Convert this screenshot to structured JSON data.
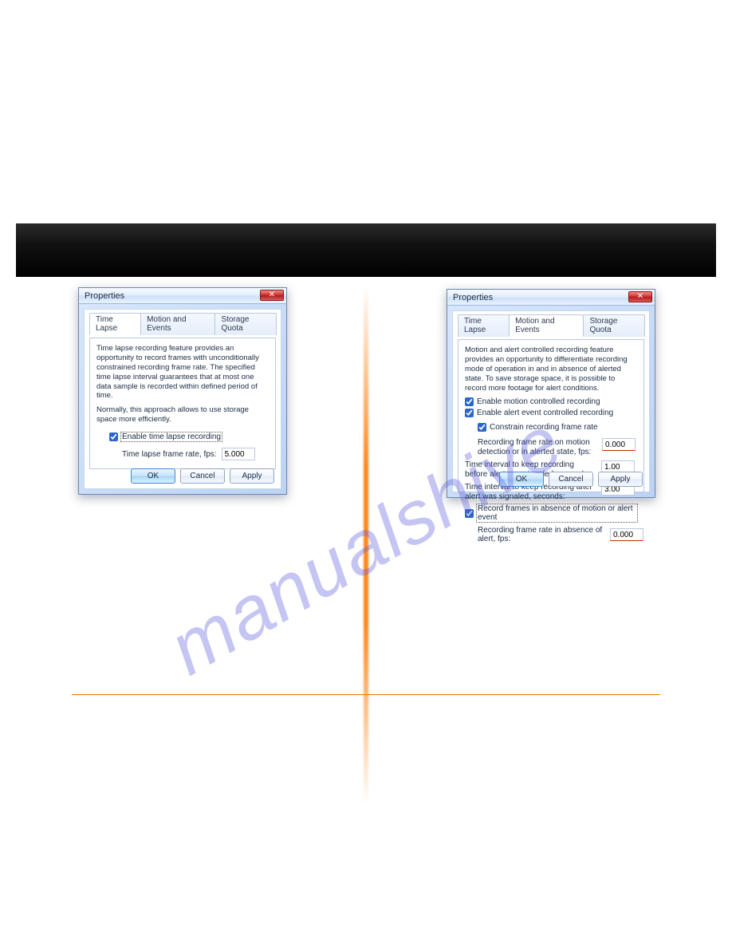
{
  "watermark": "manualshive",
  "dialogLeft": {
    "title": "Properties",
    "closeGlyph": "✕",
    "tabs": {
      "a": "Time Lapse",
      "b": "Motion and Events",
      "c": "Storage Quota"
    },
    "desc1": "Time lapse recording feature provides an opportunity to record frames with unconditionally constrained recording frame rate. The specified time lapse interval guarantees that at most one data sample is recorded within defined period of time.",
    "desc2": "Normally, this approach allows to use storage space more efficiently.",
    "cbEnable": "Enable time lapse recording",
    "frameLabel": "Time lapse frame rate, fps:",
    "frameValue": "5.000",
    "buttons": {
      "ok": "OK",
      "cancel": "Cancel",
      "apply": "Apply"
    }
  },
  "dialogRight": {
    "title": "Properties",
    "closeGlyph": "✕",
    "tabs": {
      "a": "Time Lapse",
      "b": "Motion and Events",
      "c": "Storage Quota"
    },
    "desc": "Motion and alert controlled recording feature provides an opportunity to differentiate recording mode of operation in and in absence of alerted state. To save storage space, it is possible to record more footage for alert conditions.",
    "cbMotion": "Enable motion controlled recording",
    "cbAlert": "Enable alert event controlled recording",
    "cbConstrain": "Constrain recording frame rate",
    "lblRateDet": "Recording frame rate on motion detection or in alerted state, fps:",
    "valRateDet": "0.000",
    "lblBefore": "Time interval to keep recording before alert was signaled, seconds:",
    "valBefore": "1.00",
    "lblAfter": "Time interval to keep recording after alert was signaled, seconds:",
    "valAfter": "3.00",
    "cbAbsence": "Record frames in absence of motion or alert event",
    "lblRateAbs": "Recording frame rate in absence of alert, fps:",
    "valRateAbs": "0.000",
    "buttons": {
      "ok": "OK",
      "cancel": "Cancel",
      "apply": "Apply"
    }
  }
}
